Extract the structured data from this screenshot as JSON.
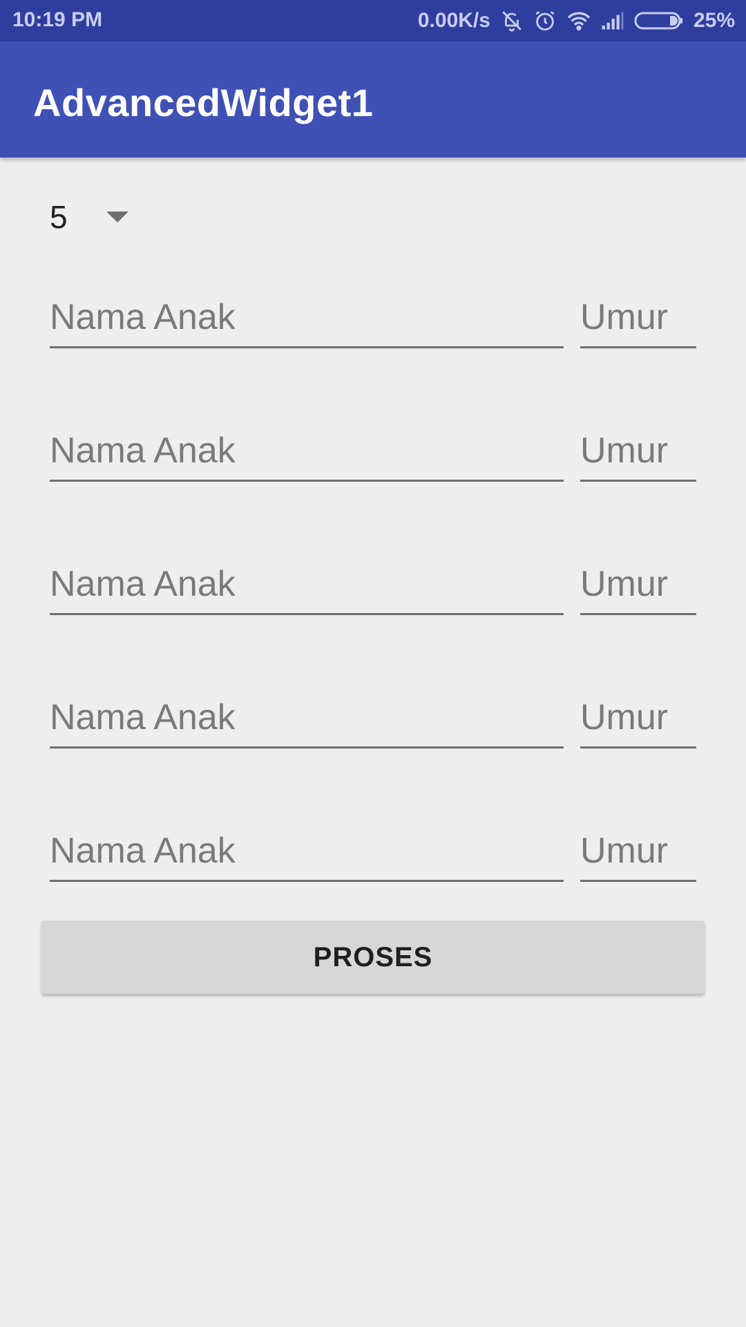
{
  "status_bar": {
    "time": "10:19 PM",
    "network_speed": "0.00K/s",
    "battery": "25%",
    "icons": [
      "bell-off-icon",
      "alarm-icon",
      "wifi-icon",
      "signal-icon",
      "battery-icon"
    ]
  },
  "app_bar": {
    "title": "AdvancedWidget1"
  },
  "spinner": {
    "selected": "5"
  },
  "rows": [
    {
      "name_placeholder": "Nama Anak",
      "age_placeholder": "Umur"
    },
    {
      "name_placeholder": "Nama Anak",
      "age_placeholder": "Umur"
    },
    {
      "name_placeholder": "Nama Anak",
      "age_placeholder": "Umur"
    },
    {
      "name_placeholder": "Nama Anak",
      "age_placeholder": "Umur"
    },
    {
      "name_placeholder": "Nama Anak",
      "age_placeholder": "Umur"
    }
  ],
  "button": {
    "label": "PROSES"
  },
  "colors": {
    "status_bar": "#2f3e9e",
    "app_bar": "#3f51b5",
    "background": "#eeeeef",
    "button": "#d6d7d7"
  }
}
